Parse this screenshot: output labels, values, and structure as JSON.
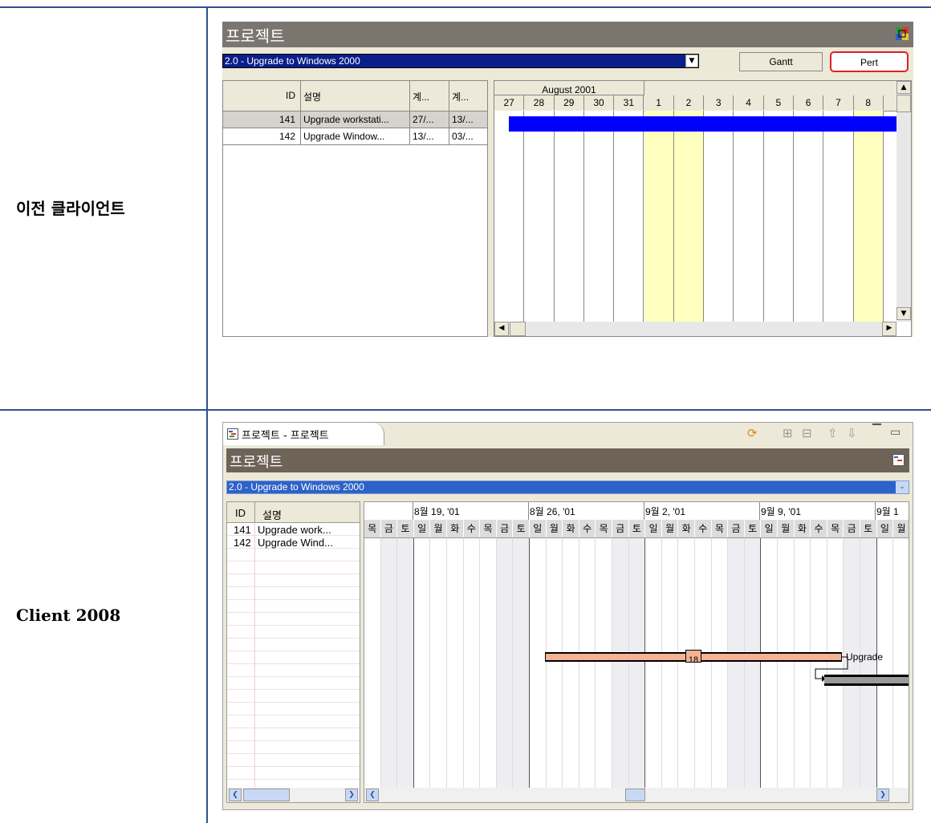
{
  "labels": {
    "old_client": "이전 클라이언트",
    "new_client": "Client 2008"
  },
  "old": {
    "header_title": "프로젝트",
    "project_select": "2.0 - Upgrade to Windows 2000",
    "gantt_button": "Gantt",
    "pert_button": "Pert",
    "columns": [
      "ID",
      "설명",
      "계...",
      "계..."
    ],
    "rows": [
      {
        "id": "141",
        "desc": "Upgrade workstati...",
        "c1": "27/...",
        "c2": "13/..."
      },
      {
        "id": "142",
        "desc": "Upgrade Window...",
        "c1": "13/...",
        "c2": "03/..."
      }
    ],
    "month_label": "August 2001",
    "days": [
      "27",
      "28",
      "29",
      "30",
      "31",
      "1",
      "2",
      "3",
      "4",
      "5",
      "6",
      "7",
      "8"
    ],
    "weekend_days": [
      "1",
      "2",
      "8"
    ],
    "bar_color": "#0000ff",
    "weekend_color": "#ffffc0"
  },
  "new": {
    "tab_title": "프로젝트 - 프로젝트",
    "header_title": "프로젝트",
    "project_select": "2.0 - Upgrade to Windows 2000",
    "columns": [
      "ID",
      "설명"
    ],
    "rows": [
      {
        "id": "141",
        "desc": "Upgrade work..."
      },
      {
        "id": "142",
        "desc": "Upgrade Wind..."
      }
    ],
    "weeks": [
      "8월 19, '01",
      "8월 26, '01",
      "9월 2, '01",
      "9월 9, '01",
      "9월 1"
    ],
    "weekdays": [
      "목",
      "금",
      "토",
      "일",
      "월",
      "화",
      "수",
      "목",
      "금",
      "토",
      "일",
      "월",
      "화",
      "수",
      "목",
      "금",
      "토",
      "일",
      "월",
      "화",
      "수",
      "목",
      "금",
      "토",
      "일",
      "월",
      "화",
      "수",
      "목",
      "금",
      "토",
      "일",
      "월"
    ],
    "task_duration_label": "18",
    "task_caption": "Upgrade",
    "task_bar_color": "#f4b394",
    "header_color": "#6d6357",
    "select_color": "#2d62c8"
  }
}
